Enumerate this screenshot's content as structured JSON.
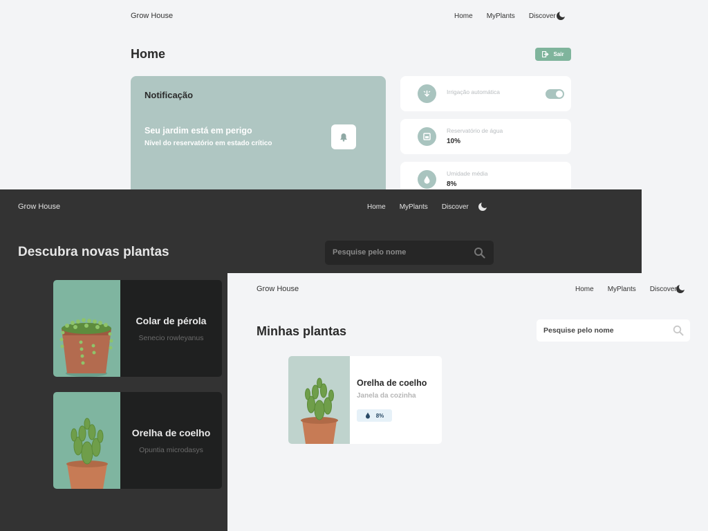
{
  "home_screen": {
    "nav": {
      "brand": "Grow House",
      "links": [
        "Home",
        "MyPlants",
        "Discover"
      ]
    },
    "title": "Home",
    "logout_label": "Sair",
    "notification": {
      "title": "Notificação",
      "message": "Seu jardim está em perigo",
      "detail": "Nível do reservatório em estado crítico"
    },
    "status_cards": [
      {
        "label": "Irrigação automática",
        "value": "",
        "icon": "watering-icon",
        "toggle_on": true
      },
      {
        "label": "Reservatório de água",
        "value": "10%",
        "icon": "reservoir-icon"
      },
      {
        "label": "Umidade média",
        "value": "8%",
        "icon": "water-drop-icon"
      }
    ]
  },
  "discover_screen": {
    "nav": {
      "brand": "Grow House",
      "links": [
        "Home",
        "MyPlants",
        "Discover"
      ]
    },
    "title": "Descubra novas plantas",
    "search_placeholder": "Pesquise pelo nome",
    "plants": [
      {
        "name": "Colar de pérola",
        "scientific_name": "Senecio rowleyanus"
      },
      {
        "name": "Orelha de coelho",
        "scientific_name": "Opuntia microdasys"
      }
    ]
  },
  "myplants_screen": {
    "nav": {
      "brand": "Grow House",
      "links": [
        "Home",
        "MyPlants",
        "Discover"
      ]
    },
    "title": "Minhas plantas",
    "search_placeholder": "Pesquise pelo nome",
    "plants": [
      {
        "name": "Orelha de coelho",
        "location": "Janela da cozinha",
        "humidity": "8%"
      }
    ]
  },
  "colors": {
    "accent_green": "#7fb49c",
    "notification_bg": "#afc6c2",
    "dark_bg": "#333333",
    "light_bg": "#f3f4f6"
  }
}
